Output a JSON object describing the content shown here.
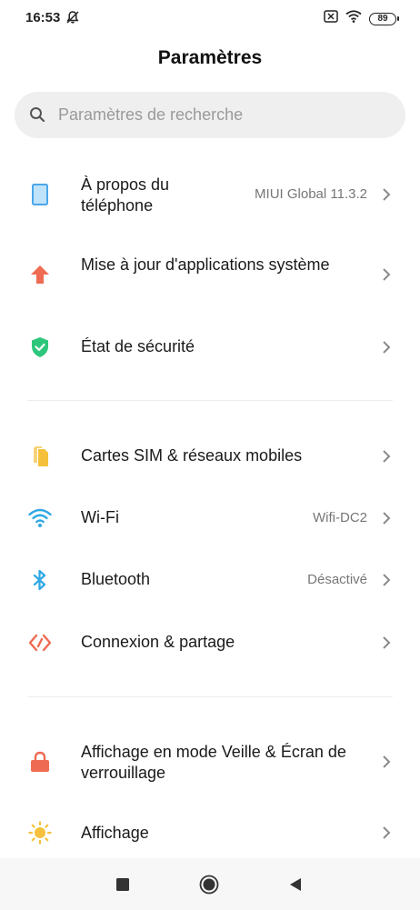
{
  "status_bar": {
    "time": "16:53",
    "battery": "89",
    "icons": [
      "bell-off-icon",
      "sim-x-icon",
      "wifi-icon",
      "battery-icon"
    ]
  },
  "header": {
    "title": "Paramètres"
  },
  "search": {
    "placeholder": "Paramètres de recherche"
  },
  "settings": {
    "groups": [
      {
        "items": [
          {
            "label": "À propos du téléphone",
            "value": "MIUI Global 11.3.2",
            "icon": "phone-icon",
            "color": "#4aa7e8"
          },
          {
            "label": "Mise à jour d'applications système",
            "value": "",
            "icon": "arrow-up-icon",
            "color": "#ee6a52"
          },
          {
            "label": "État de sécurité",
            "value": "",
            "icon": "shield-check-icon",
            "color": "#2ec67a"
          }
        ]
      },
      {
        "items": [
          {
            "label": "Cartes SIM & réseaux mobiles",
            "value": "",
            "icon": "sim-card-icon",
            "color": "#f5c03b"
          },
          {
            "label": "Wi-Fi",
            "value": "Wifi-DC2",
            "icon": "wifi-icon",
            "color": "#2fa8e4"
          },
          {
            "label": "Bluetooth",
            "value": "Désactivé",
            "icon": "bluetooth-icon",
            "color": "#2fa8e4"
          },
          {
            "label": "Connexion & partage",
            "value": "",
            "icon": "share-connection-icon",
            "color": "#ee6a52"
          }
        ]
      },
      {
        "items": [
          {
            "label": "Affichage en mode Veille & Écran de verrouillage",
            "value": "",
            "icon": "lock-icon",
            "color": "#ee6a52"
          },
          {
            "label": "Affichage",
            "value": "",
            "icon": "brightness-icon",
            "color": "#f5c03b"
          }
        ]
      }
    ]
  },
  "navigation": {
    "buttons": [
      {
        "icon": "recent-apps-icon"
      },
      {
        "icon": "home-icon"
      },
      {
        "icon": "back-icon"
      }
    ]
  }
}
